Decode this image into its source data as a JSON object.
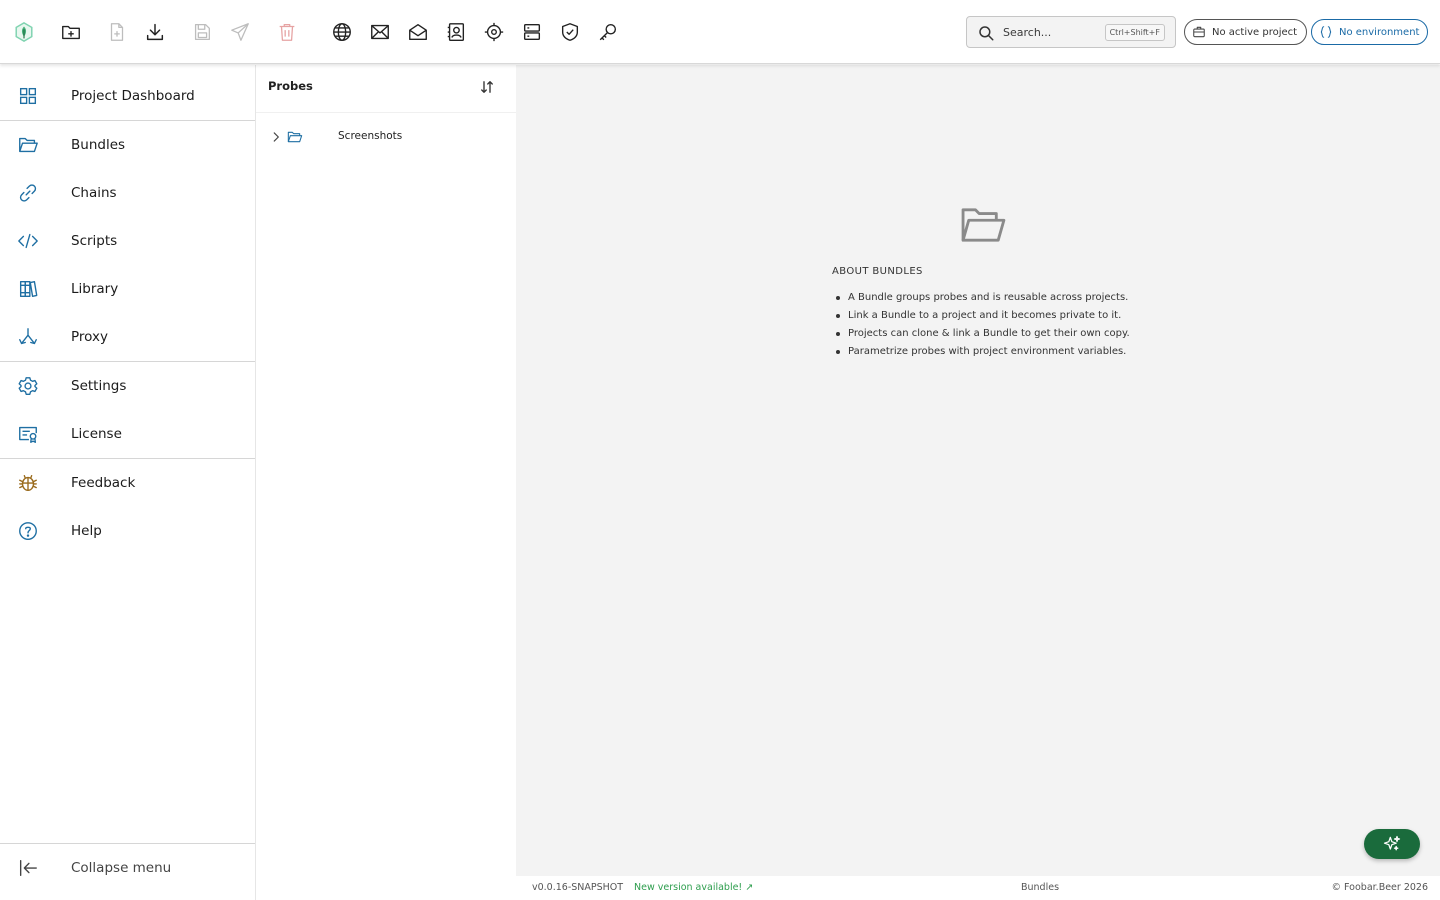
{
  "toolbar": {
    "icons": [
      "app-logo",
      "new-bundle",
      "new-probe",
      "download",
      "save",
      "send",
      "delete",
      "globe",
      "mail",
      "mail-open",
      "contacts",
      "target",
      "server",
      "shield-check",
      "key"
    ],
    "search": {
      "placeholder": "Search...",
      "shortcut": "Ctrl+Shift+F"
    },
    "project_pill": "No active project",
    "environment_pill": "No environment"
  },
  "sidebar": {
    "items": [
      {
        "label": "Project Dashboard",
        "icon": "grid-icon"
      },
      {
        "label": "Bundles",
        "icon": "folder-open-icon"
      },
      {
        "label": "Chains",
        "icon": "link-icon"
      },
      {
        "label": "Scripts",
        "icon": "code-icon"
      },
      {
        "label": "Library",
        "icon": "books-icon"
      },
      {
        "label": "Proxy",
        "icon": "split-arrows-icon"
      },
      {
        "label": "Settings",
        "icon": "gear-icon"
      },
      {
        "label": "License",
        "icon": "certificate-icon"
      },
      {
        "label": "Feedback",
        "icon": "bug-icon"
      },
      {
        "label": "Help",
        "icon": "help-circle-icon"
      }
    ],
    "collapse_label": "Collapse menu"
  },
  "probes": {
    "title": "Probes",
    "tree": [
      {
        "label": "Screenshots",
        "type": "folder",
        "expanded": false
      }
    ]
  },
  "about": {
    "title": "ABOUT BUNDLES",
    "points": [
      "A Bundle groups probes and is reusable across projects.",
      "Link a Bundle to a project and it becomes private to it.",
      "Projects can clone & link a Bundle to get their own copy.",
      "Parametrize probes with project environment variables."
    ]
  },
  "footer": {
    "version": "v0.0.16-SNAPSHOT",
    "update_link": "New version available! ↗",
    "current_page": "Bundles",
    "copyright": "© Foobar.Beer 2026"
  },
  "colors": {
    "accent_green": "#1a6b3c",
    "update_green": "#2e9e4e",
    "environment_blue": "#1a6aa6",
    "sidebar_icon_blue": "#1f6fa3",
    "feedback_icon_brown": "#9a6b1d",
    "delete_disabled_red": "#e6a3a3"
  }
}
